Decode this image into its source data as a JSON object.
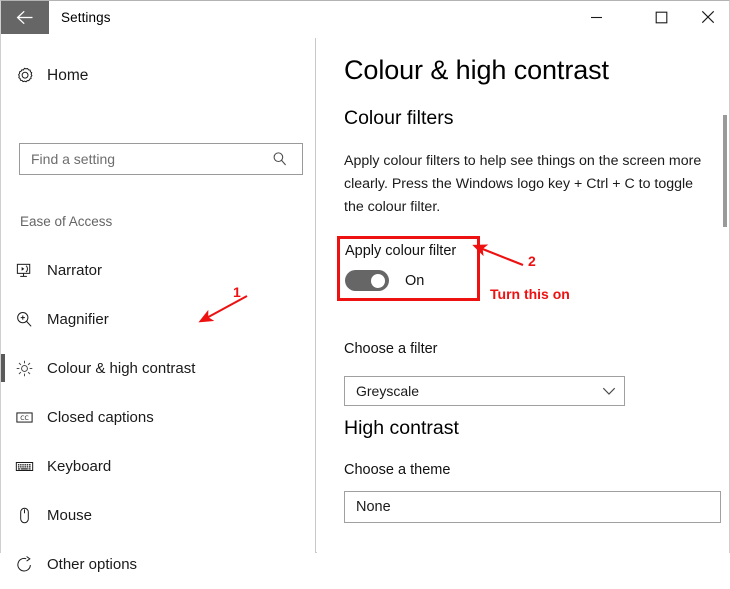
{
  "window": {
    "title": "Settings",
    "back_icon": "back-arrow-icon",
    "minimize_label": "—",
    "maximize_label": "□",
    "close_label": "✕"
  },
  "sidebar": {
    "home": {
      "label": "Home",
      "icon": "gear-icon"
    },
    "search": {
      "value": "",
      "placeholder": "Find a setting",
      "icon": "search-icon"
    },
    "category": "Ease of Access",
    "items": [
      {
        "label": "Narrator",
        "icon": "narrator-icon",
        "selected": false
      },
      {
        "label": "Magnifier",
        "icon": "magnifier-icon",
        "selected": false
      },
      {
        "label": "Colour & high contrast",
        "icon": "brightness-icon",
        "selected": true
      },
      {
        "label": "Closed captions",
        "icon": "closed-captions-icon",
        "selected": false
      },
      {
        "label": "Keyboard",
        "icon": "keyboard-icon",
        "selected": false
      },
      {
        "label": "Mouse",
        "icon": "mouse-icon",
        "selected": false
      },
      {
        "label": "Other options",
        "icon": "other-options-icon",
        "selected": false
      }
    ]
  },
  "main": {
    "page_title": "Colour & high contrast",
    "colour_filters": {
      "heading": "Colour filters",
      "description": "Apply colour filters to help see things on the screen more clearly. Press the Windows logo key + Ctrl + C to toggle the colour filter.",
      "toggle_label": "Apply colour filter",
      "toggle_state": "On",
      "choose_filter_label": "Choose a filter",
      "filter_selected": "Greyscale"
    },
    "high_contrast": {
      "heading": "High contrast",
      "choose_theme_label": "Choose a theme",
      "theme_selected": "None"
    }
  },
  "annotations": {
    "one": {
      "number": "1"
    },
    "two": {
      "number": "2",
      "text": "Turn this on"
    }
  },
  "colors": {
    "annotation_red": "#ee1111",
    "back_button_bg": "#666666",
    "toggle_on_bg": "#666666",
    "selection_bar": "#5a5a5a",
    "scrollbar_thumb": "#9a9a9a"
  }
}
